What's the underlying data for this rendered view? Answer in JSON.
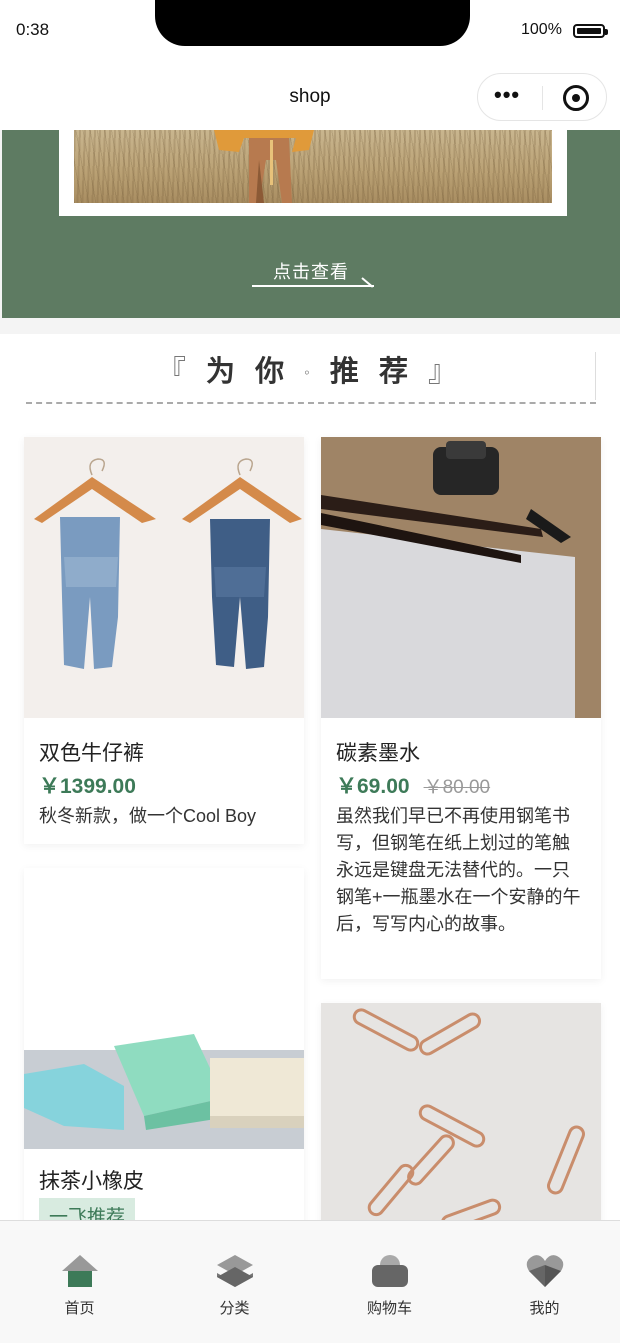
{
  "status_bar": {
    "time": "0:38",
    "battery": "100%"
  },
  "navbar": {
    "title": "shop"
  },
  "banner": {
    "link_text": "点击查看"
  },
  "recommend": {
    "title_left": "『",
    "title_a": "为 你",
    "title_dot": "◦",
    "title_b": "推 荐",
    "title_right": "』"
  },
  "products": [
    {
      "name": "双色牛仔裤",
      "price": "￥1399.00",
      "desc": "秋冬新款，做一个Cool Boy"
    },
    {
      "name": "碳素墨水",
      "price": "￥69.00",
      "old_price": "￥80.00",
      "desc": "虽然我们早已不再使用钢笔书写，但钢笔在纸上划过的笔触永远是键盘无法替代的。一只钢笔+一瓶墨水在一个安静的午后，写写内心的故事。"
    },
    {
      "name": "抹茶小橡皮",
      "tag": "一飞推荐"
    },
    {
      "name": ""
    }
  ],
  "tabbar": {
    "items": [
      {
        "label": "首页",
        "icon": "home-icon",
        "active": true
      },
      {
        "label": "分类",
        "icon": "category-icon"
      },
      {
        "label": "购物车",
        "icon": "cart-icon"
      },
      {
        "label": "我的",
        "icon": "heart-icon"
      }
    ],
    "active_color": "#3d7a58",
    "inactive_color": "#666666"
  },
  "colors": {
    "brand": "#5e7b62",
    "price": "#3d7a58"
  }
}
